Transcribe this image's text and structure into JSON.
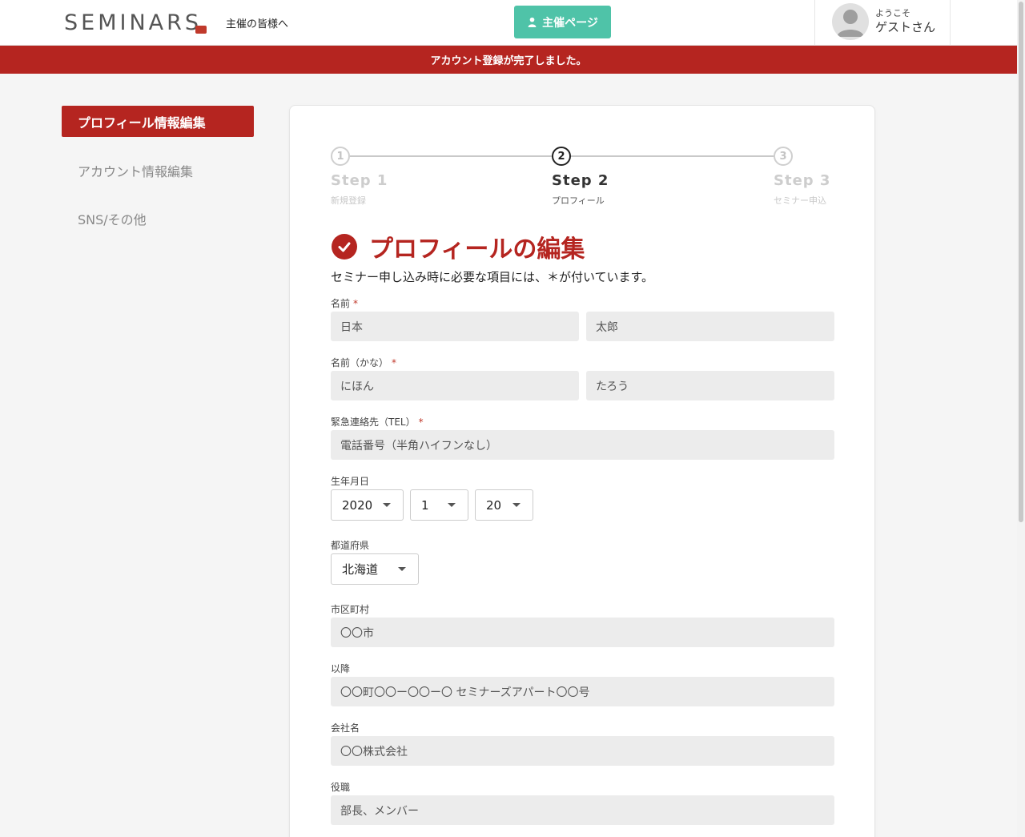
{
  "header": {
    "logo": "SEMINARS",
    "host_link": "主催の皆様へ",
    "host_button": "主催ページ",
    "welcome": "ようこそ",
    "user_name": "ゲストさん"
  },
  "banner": "アカウント登録が完了しました。",
  "sidebar": {
    "items": [
      {
        "label": "プロフィール情報編集"
      },
      {
        "label": "アカウント情報編集"
      },
      {
        "label": "SNS/その他"
      }
    ]
  },
  "stepper": {
    "steps": [
      {
        "number": "1",
        "title": "Step 1",
        "sub": "新規登録"
      },
      {
        "number": "2",
        "title": "Step 2",
        "sub": "プロフィール"
      },
      {
        "number": "3",
        "title": "Step 3",
        "sub": "セミナー申込"
      }
    ]
  },
  "form": {
    "heading": "プロフィールの編集",
    "lead": "セミナー申し込み時に必要な項目には、＊が付いています。",
    "required_mark": "*",
    "name_label": "名前",
    "name_last": "日本",
    "name_first": "太郎",
    "kana_label": "名前（かな）",
    "kana_last": "にほん",
    "kana_first": "たろう",
    "tel_label": "緊急連絡先（TEL）",
    "tel_placeholder": "電話番号（半角ハイフンなし）",
    "birth_label": "生年月日",
    "birth_year": "2020",
    "birth_month": "1",
    "birth_day": "20",
    "pref_label": "都道府県",
    "pref_value": "北海道",
    "city_label": "市区町村",
    "city_placeholder": "〇〇市",
    "address_label": "以降",
    "address_placeholder": "〇〇町〇〇ー〇〇ー〇 セミナーズアパート〇〇号",
    "company_label": "会社名",
    "company_placeholder": "〇〇株式会社",
    "position_label": "役職",
    "position_placeholder": "部長、メンバー"
  }
}
